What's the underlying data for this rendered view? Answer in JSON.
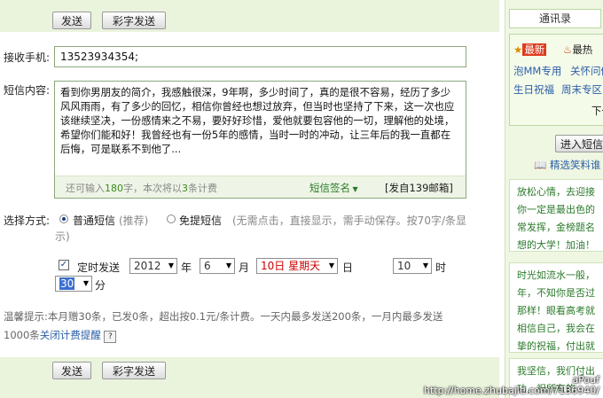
{
  "toolbar": {
    "send_label": "发送",
    "color_send_label": "彩字发送"
  },
  "form": {
    "phone_label": "接收手机:",
    "phone_value": "13523934354;",
    "content_label": "短信内容:",
    "content_text": "看到你男朋友的简介，我感触很深，9年啊，多少时间了，真的是很不容易，经历了多少风风雨雨，有了多少的回忆，相信你曾经也想过放弃，但当时也坚持了下来，这一次也应该继续坚决，一份感情来之不易，要好好珍惜，爱他就要包容他的一切，理解他的处境，希望你们能和好！我曾经也有一份5年的感情，当时一时的冲动，让三年后的我一直都在后悔，可是联系不到他了...",
    "remain_prefix": "还可输入",
    "remain_count": "180",
    "remain_mid": "字，本次将以",
    "charge_count": "3",
    "remain_suffix": "条计费",
    "signature_label": "短信签名",
    "sender_tag": "[发自139邮箱]",
    "mode_label": "选择方式:",
    "mode_normal": "普通短信",
    "mode_normal_note": "(推荐)",
    "mode_free": "免提短信",
    "mode_free_note": "(无需点击，直接显示，需手动保存。按70字/条显",
    "mode_free_note2": "示)",
    "timed_label": "定时发送",
    "year": "2012",
    "year_unit": "年",
    "month": "6",
    "month_unit": "月",
    "day": "10日 星期天",
    "day_unit": "日",
    "hour": "10",
    "hour_unit": "时",
    "minute": "30",
    "minute_unit": "分",
    "tip_line1": "温馨提示:本月赠30条，已发0条，超出按0.1元/条计费。一天内最多发送200条，一月内最多发送",
    "tip_line2_prefix": "1000条",
    "tip_link": "关闭计费提醒",
    "tip_help": "?"
  },
  "sidebar": {
    "tab": "通讯录",
    "tag_new": "最新",
    "tag_hot": "最热",
    "link1": "泡MM专用",
    "link2": "关怀问候",
    "link3": "生日祝福",
    "link4": "周末专区",
    "more": "下一",
    "enter_button": "进入短信",
    "featured": "精选笑料谁",
    "quote1": [
      "放松心情，去迎接",
      "你一定是最出色的",
      "常发挥，金榜题名",
      "想的大学！加油！"
    ],
    "quote2": [
      "时光如流水一般，",
      "年，不知你是否过",
      "那样！眼看高考就",
      "相信自己，我会在",
      "挚的祝福，付出就"
    ],
    "quote3": [
      "我坚信，我们付出",
      "功，祝所有的"
    ]
  },
  "watermark": {
    "line1": "aPouf",
    "line2": "http://home.zhubajie.com/7136940/"
  },
  "colors": {
    "accent_green": "#eaf3dc",
    "link_blue": "#2b5fa8",
    "date_red": "#cc0000"
  }
}
